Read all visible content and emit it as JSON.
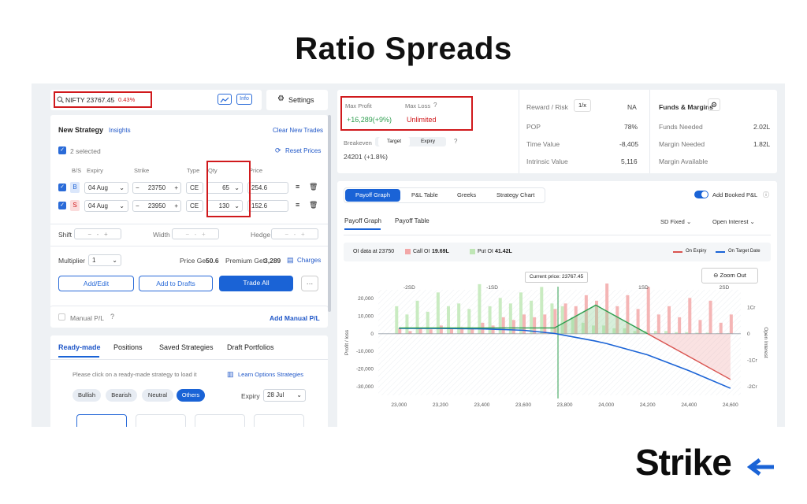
{
  "page_title": "Ratio Spreads",
  "brand": {
    "logo_text": "Strike"
  },
  "search": {
    "value": "NIFTY 23767.45",
    "change": "0.43%"
  },
  "header_buttons": {
    "info": "Info",
    "settings": "Settings"
  },
  "strategy": {
    "title": "New Strategy",
    "insights": "Insights",
    "clear": "Clear New Trades",
    "selected": "2 selected",
    "reset": "Reset Prices",
    "columns": [
      "B/S",
      "Expiry",
      "Strike",
      "Type",
      "Qty",
      "Price"
    ],
    "legs": [
      {
        "side": "B",
        "expiry": "04 Aug",
        "strike": "23750",
        "type": "CE",
        "qty": "65",
        "price": "254.6"
      },
      {
        "side": "S",
        "expiry": "04 Aug",
        "strike": "23950",
        "type": "CE",
        "qty": "130",
        "price": "152.6"
      }
    ],
    "shift": "Shift",
    "width": "Width",
    "hedge": "Hedge",
    "multiplier_label": "Multiplier",
    "multiplier": "1",
    "price_get_label": "Price Get",
    "price_get": "50.6",
    "premium_get_label": "Premium Get",
    "premium_get": "3,289",
    "charges": "Charges",
    "add_edit": "Add/Edit",
    "add_drafts": "Add to Drafts",
    "trade_all": "Trade All",
    "manual_pl": "Manual P/L",
    "add_manual_pl": "Add Manual P/L"
  },
  "readymade": {
    "tabs": [
      "Ready-made",
      "Positions",
      "Saved Strategies",
      "Draft Portfolios"
    ],
    "hint": "Please click on a ready-made strategy to load it",
    "learn": "Learn Options Strategies",
    "filters": [
      "Bullish",
      "Bearish",
      "Neutral",
      "Others"
    ],
    "expiry_label": "Expiry",
    "expiry": "28 Jul"
  },
  "summary": {
    "max_profit_label": "Max Profit",
    "max_profit": "+16,289(+9%)",
    "max_loss_label": "Max Loss",
    "max_loss": "Unlimited",
    "breakeven_label": "Breakeven",
    "breakeven_tabs": [
      "Target",
      "Expiry"
    ],
    "breakeven_value": "24201 (+1.8%)",
    "rr_label": "Reward / Risk",
    "rr_toggle": "1/x",
    "rr_value": "NA",
    "pop_label": "POP",
    "pop_value": "78%",
    "tv_label": "Time Value",
    "tv_value": "-8,405",
    "iv_label": "Intrinsic Value",
    "iv_value": "5,116",
    "funds_title": "Funds & Margins",
    "funds_needed_label": "Funds Needed",
    "funds_needed": "2.02L",
    "margin_needed_label": "Margin Needed",
    "margin_needed": "1.82L",
    "margin_available_label": "Margin Available"
  },
  "graph_panel": {
    "tabs": [
      "Payoff Graph",
      "P&L Table",
      "Greeks",
      "Strategy Chart"
    ],
    "add_booked": "Add Booked P&L",
    "subtabs": [
      "Payoff Graph",
      "Payoff Table"
    ],
    "sd": "SD Fixed",
    "oi": "Open Interest",
    "oi_data": "OI data at 23750",
    "call_oi_label": "Call OI",
    "call_oi": "19.69L",
    "put_oi_label": "Put OI",
    "put_oi": "41.42L",
    "on_expiry": "On Expiry",
    "on_target": "On Target Date",
    "current_price": "Current price: 23767.45",
    "zoom_out": "Zoom Out"
  },
  "chart_data": {
    "type": "line",
    "x": [
      23000,
      23200,
      23400,
      23600,
      23750,
      23800,
      23950,
      24000,
      24200,
      24400,
      24600
    ],
    "series": [
      {
        "name": "On Expiry",
        "color": "#d9534f",
        "values": [
          3300,
          3300,
          3300,
          3300,
          3300,
          6550,
          16289,
          13039,
          39,
          -12961,
          -25961
        ]
      },
      {
        "name": "On Target Date",
        "color": "#1a63d6",
        "values": [
          3100,
          3000,
          2800,
          2000,
          200,
          -900,
          -4200,
          -5500,
          -12000,
          -21000,
          -31000
        ]
      }
    ],
    "x_ticks": [
      "23,000",
      "23,200",
      "23,400",
      "23,600",
      "23,800",
      "24,000",
      "24,200",
      "24,400",
      "24,600"
    ],
    "y_ticks": [
      "20,000",
      "10,000",
      "0",
      "-10,000",
      "-20,000",
      "-30,000"
    ],
    "sd_ticks": [
      "-2SD",
      "-1SD",
      "1SD",
      "2SD"
    ],
    "ylabel": "Profit / loss",
    "right_ticks": [
      "1Cr",
      "0",
      "-1Cr",
      "-2Cr"
    ],
    "right_label": "Open Interest",
    "xlim": [
      22900,
      24650
    ],
    "ylim": [
      -35000,
      25000
    ],
    "oi_bars": {
      "strikes": [
        23000,
        23050,
        23100,
        23150,
        23200,
        23250,
        23300,
        23350,
        23400,
        23450,
        23500,
        23550,
        23600,
        23650,
        23700,
        23750,
        23800,
        23850,
        23900,
        23950,
        24000,
        24050,
        24100,
        24150,
        24200,
        24250,
        24300,
        24350,
        24400,
        24450,
        24500,
        24550,
        24600
      ],
      "call": [
        0.1,
        0.05,
        0.1,
        0.08,
        0.15,
        0.1,
        0.12,
        0.1,
        0.2,
        0.15,
        0.3,
        0.25,
        0.35,
        0.3,
        0.35,
        0.45,
        0.55,
        0.5,
        0.7,
        0.6,
        1.0,
        0.5,
        0.7,
        0.45,
        0.85,
        0.35,
        0.5,
        0.3,
        0.65,
        0.25,
        0.6,
        0.2,
        0.35
      ],
      "put": [
        0.5,
        0.35,
        0.6,
        0.4,
        0.75,
        0.5,
        0.55,
        0.45,
        0.9,
        0.5,
        0.65,
        0.55,
        0.75,
        0.6,
        0.85,
        0.55,
        0.5,
        0.3,
        0.2,
        0.15,
        0.15,
        0.1,
        0.1,
        0.05,
        0.05,
        0.05,
        0.05,
        0.03,
        0.03,
        0.02,
        0.02,
        0.01,
        0.01
      ]
    }
  },
  "colors": {
    "accent": "#1a63d6",
    "profit": "#2e9e4f",
    "loss": "#d0191c",
    "highlight": "#d0191c"
  }
}
